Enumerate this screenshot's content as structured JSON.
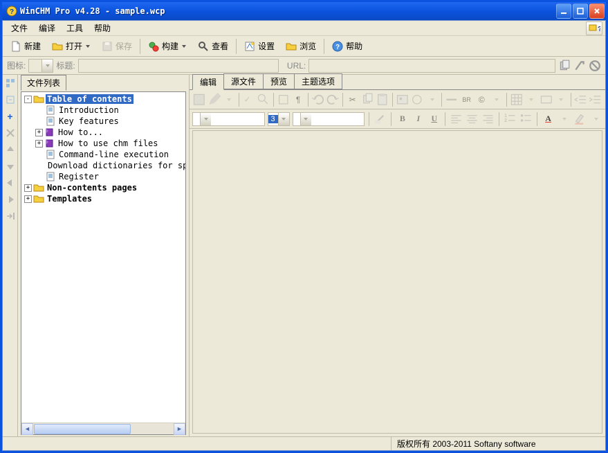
{
  "title": "WinCHM Pro v4.28 - sample.wcp",
  "menu": {
    "file": "文件",
    "compile": "编译",
    "tools": "工具",
    "help": "帮助"
  },
  "toolbar": {
    "new": "新建",
    "open": "打开",
    "save": "保存",
    "build": "构建",
    "view": "查看",
    "settings": "设置",
    "browse": "浏览",
    "help": "帮助"
  },
  "iconbar": {
    "icon_lbl": "图标:",
    "title_lbl": "标题:",
    "url_lbl": "URL:"
  },
  "left": {
    "tab": "文件列表",
    "tree": {
      "root": "Table of contents",
      "items": [
        "Introduction",
        "Key features",
        "How to...",
        "How to use chm files",
        "Command-line execution",
        "Download dictionaries for sp",
        "Register"
      ],
      "noncontents": "Non-contents pages",
      "templates": "Templates"
    }
  },
  "right": {
    "tabs": {
      "edit": "编辑",
      "source": "源文件",
      "preview": "预览",
      "options": "主题选项"
    },
    "fontsize": "3",
    "br_label": "BR"
  },
  "status": {
    "copyright": "版权所有 2003-2011 Softany software"
  }
}
